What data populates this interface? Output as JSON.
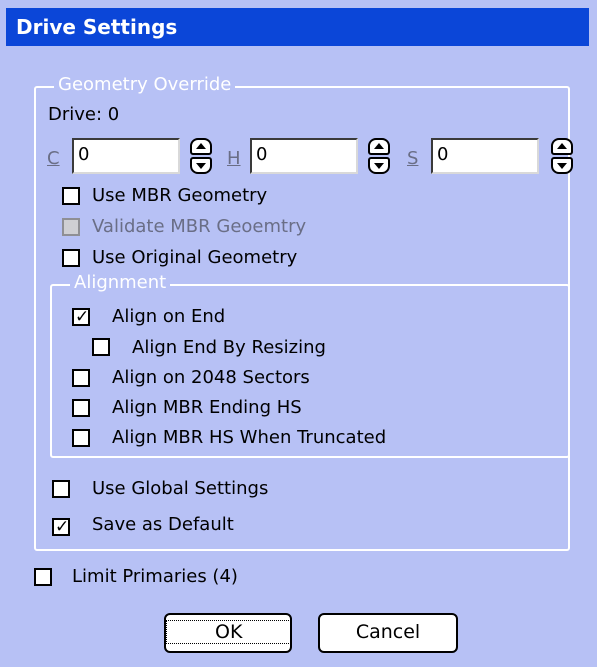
{
  "window": {
    "title": "Drive Settings"
  },
  "geometry_override": {
    "legend": "Geometry Override",
    "drive_label": "Drive: 0",
    "c_label": "C",
    "c_value": "0",
    "h_label": "H",
    "h_value": "0",
    "s_label": "S",
    "s_value": "0",
    "use_mbr_geometry": "Use MBR Geometry",
    "validate_mbr_geometry": "Validate MBR Geoemtry",
    "use_original_geometry": "Use Original Geometry"
  },
  "alignment": {
    "legend": "Alignment",
    "align_on_end": {
      "label": "Align on End",
      "checked": true
    },
    "align_end_by_resizing": {
      "label": "Align End By Resizing",
      "checked": false
    },
    "align_2048": {
      "label": "Align on 2048 Sectors",
      "checked": false
    },
    "align_mbr_ending_hs": {
      "label": "Align MBR Ending HS",
      "checked": false
    },
    "align_mbr_hs_truncated": {
      "label": "Align MBR HS When Truncated",
      "checked": false
    }
  },
  "use_global_settings": {
    "label": "Use Global Settings",
    "checked": false
  },
  "save_as_default": {
    "label": "Save as Default",
    "checked": true
  },
  "limit_primaries": {
    "label": "Limit Primaries (4)",
    "checked": false
  },
  "buttons": {
    "ok": "OK",
    "cancel": "Cancel"
  },
  "colors": {
    "background": "#b7c1f5",
    "titlebar": "#0b46d8"
  }
}
